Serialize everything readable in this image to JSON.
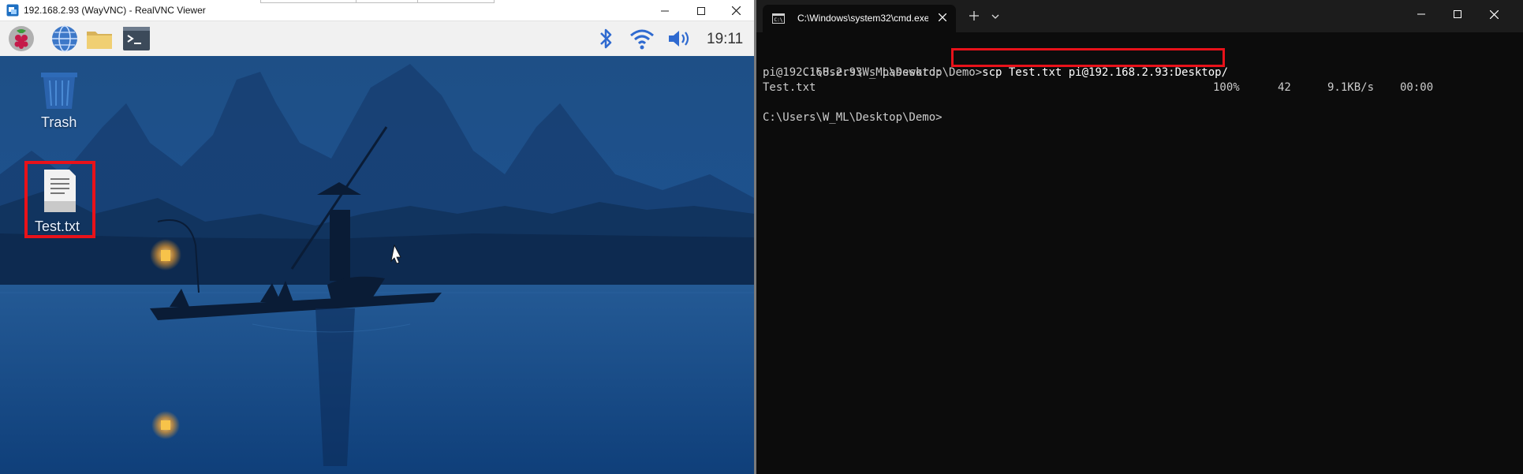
{
  "vnc": {
    "window_title": "192.168.2.93 (WayVNC) - RealVNC Viewer",
    "panel": {
      "clock": "19:11"
    },
    "desktop": {
      "icons": [
        {
          "label": "Trash"
        },
        {
          "label": "Test.txt"
        }
      ]
    }
  },
  "terminal": {
    "tab_title": "C:\\Windows\\system32\\cmd.exe",
    "lines": {
      "l1_prompt": "C:\\Users\\W_ML\\Desktop\\Demo>",
      "l1_command": "scp Test.txt pi@192.168.2.93:Desktop/",
      "l2": "pi@192.168.2.93's password:",
      "l3_file": "Test.txt",
      "l3_percent": "100%",
      "l3_size": "42",
      "l3_rate": "9.1KB/s",
      "l3_time": "00:00",
      "l5_prompt": "C:\\Users\\W_ML\\Desktop\\Demo>"
    }
  },
  "colors": {
    "highlight": "#e8121a",
    "terminal_bg": "#0c0c0c",
    "terminal_text": "#cccccc"
  }
}
